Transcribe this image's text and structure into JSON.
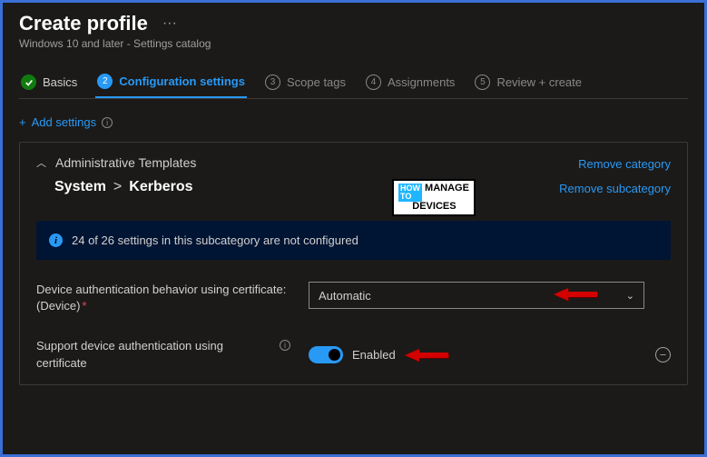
{
  "header": {
    "title": "Create profile",
    "subtitle": "Windows 10 and later - Settings catalog"
  },
  "tabs": {
    "t1": {
      "label": "Basics"
    },
    "t2": {
      "num": "2",
      "label": "Configuration settings"
    },
    "t3": {
      "num": "3",
      "label": "Scope tags"
    },
    "t4": {
      "num": "4",
      "label": "Assignments"
    },
    "t5": {
      "num": "5",
      "label": "Review + create"
    }
  },
  "actions": {
    "add_settings": "Add settings"
  },
  "category": {
    "name": "Administrative Templates",
    "crumb1": "System",
    "crumb2": "Kerberos",
    "remove_category": "Remove category",
    "remove_subcategory": "Remove subcategory"
  },
  "banner": {
    "text": "24 of 26 settings in this subcategory are not configured"
  },
  "settings": {
    "device_auth_behavior": {
      "label": "Device authentication behavior using certificate: (Device)",
      "value": "Automatic"
    },
    "support_device_auth": {
      "label": "Support device authentication using certificate",
      "status": "Enabled"
    }
  }
}
